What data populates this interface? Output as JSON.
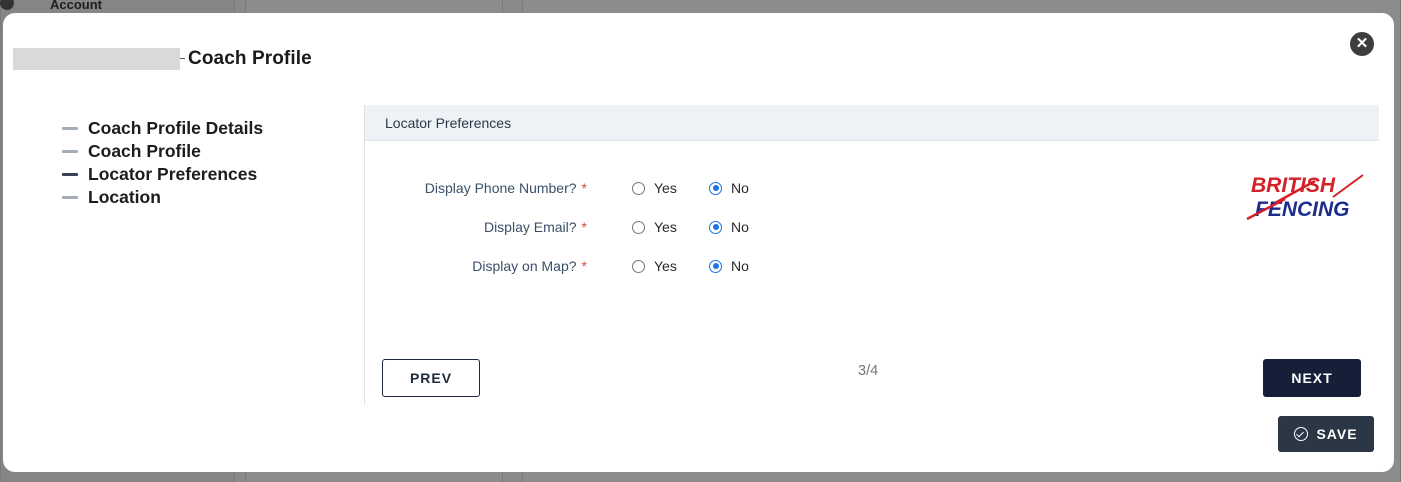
{
  "background": {
    "account_label": "Account"
  },
  "modal": {
    "title": "Coach Profile",
    "close_icon": "close-icon"
  },
  "steps": [
    {
      "label": "Coach Profile Details",
      "active": false
    },
    {
      "label": "Coach Profile",
      "active": false
    },
    {
      "label": "Locator Preferences",
      "active": true
    },
    {
      "label": "Location",
      "active": false
    }
  ],
  "section": {
    "title": "Locator Preferences"
  },
  "fields": [
    {
      "label": "Display Phone Number?",
      "required_mark": "*",
      "yes_label": "Yes",
      "no_label": "No",
      "value": "No"
    },
    {
      "label": "Display Email?",
      "required_mark": "*",
      "yes_label": "Yes",
      "no_label": "No",
      "value": "No"
    },
    {
      "label": "Display on Map?",
      "required_mark": "*",
      "yes_label": "Yes",
      "no_label": "No",
      "value": "No"
    }
  ],
  "logo": {
    "line1": "BRITISH",
    "line2": "FENCING"
  },
  "nav": {
    "prev_label": "PREV",
    "next_label": "NEXT",
    "pager": "3/4"
  },
  "save_label": "SAVE",
  "colors": {
    "primary": "#152038",
    "accent": "#1a73e8",
    "required": "#c94a4a",
    "logo_red": "#d42027",
    "logo_blue": "#1d2d8c"
  }
}
